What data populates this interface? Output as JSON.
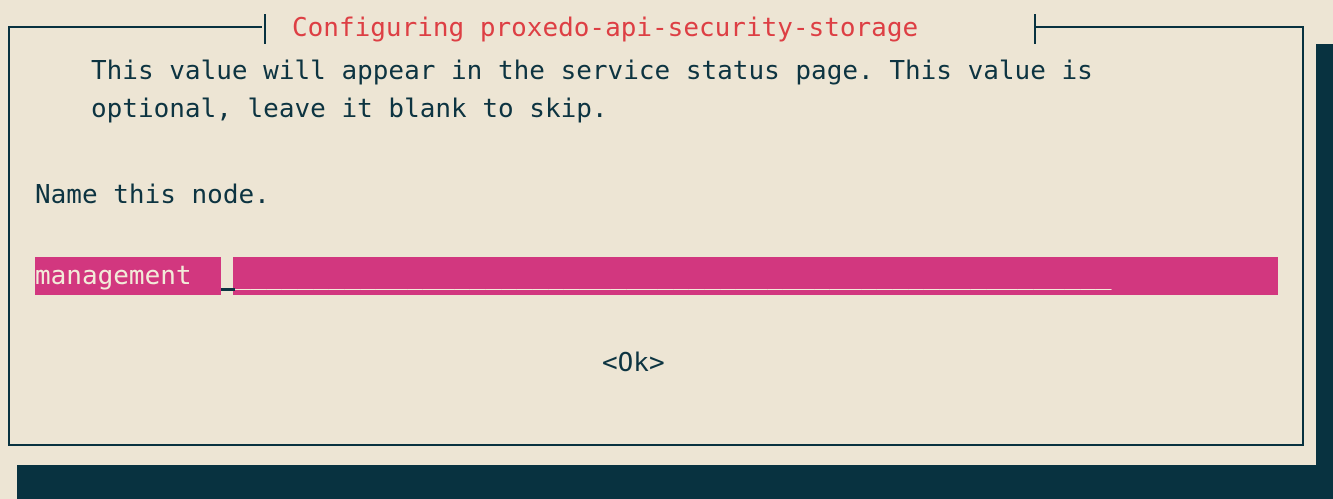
{
  "dialog": {
    "title": "Configuring proxedo-api-security-storage",
    "description_line1": "This value will appear in the service status page. This value is",
    "description_line2": "optional, leave it blank to skip.",
    "prompt": "Name this node.",
    "input": {
      "value": "management",
      "fill": "________________________________________________________"
    },
    "ok_label": "<Ok>"
  },
  "colors": {
    "background": "#ede5d4",
    "frame": "#083240",
    "title": "#dd3f44",
    "text": "#0d3441",
    "input_bg": "#d2377f",
    "input_text": "#f2ebd9",
    "shadow": "#083240"
  }
}
